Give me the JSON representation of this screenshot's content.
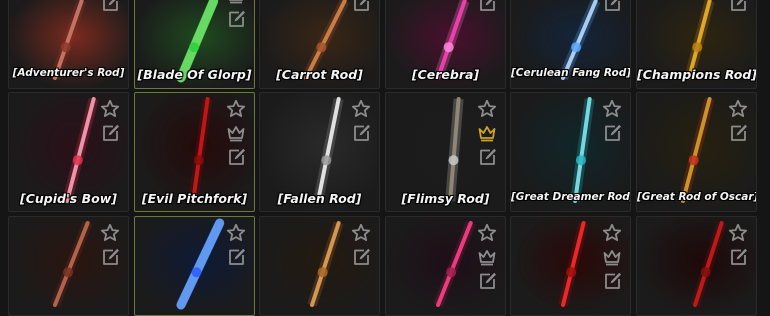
{
  "inventory": {
    "items": [
      {
        "name": "[Adventurer's Rod]",
        "icons": [
          "pencil-icon"
        ],
        "glow": "#7a2a1e",
        "shaft": "#d07a6a",
        "accent": "#8a3a2a"
      },
      {
        "name": "[Blade Of Glorp]",
        "icons": [
          "crown-icon",
          "pencil-icon"
        ],
        "glow": "#1f4a1f",
        "shaft": "#6fe86a",
        "accent": "#2ecf3a"
      },
      {
        "name": "[Carrot Rod]",
        "icons": [
          "pencil-icon"
        ],
        "glow": "#3a2615",
        "shaft": "#d7864a",
        "accent": "#a8552a"
      },
      {
        "name": "[Cerebra]",
        "icons": [
          "pencil-icon"
        ],
        "glow": "#4a0f2e",
        "shaft": "#ff3fb4",
        "accent": "#ff86dc"
      },
      {
        "name": "[Cerulean Fang Rod]",
        "icons": [
          "pencil-icon"
        ],
        "glow": "#13243a",
        "shaft": "#b8dcff",
        "accent": "#5aa8ff"
      },
      {
        "name": "[Champions Rod]",
        "icons": [
          "pencil-icon"
        ],
        "glow": "#2e2510",
        "shaft": "#f0b22e",
        "accent": "#c08010"
      },
      {
        "name": "[Cupid's Bow]",
        "icons": [
          "star-icon",
          "pencil-icon"
        ],
        "glow": "#2a1018",
        "shaft": "#ff9fb8",
        "accent": "#e2334f"
      },
      {
        "name": "[Evil Pitchfork]",
        "icons": [
          "star-icon",
          "crown-icon",
          "pencil-icon"
        ],
        "glow": "#260a0a",
        "shaft": "#d01818",
        "accent": "#8c0c0c"
      },
      {
        "name": "[Fallen Rod]",
        "icons": [
          "star-icon",
          "pencil-icon"
        ],
        "glow": "#2a2a2a",
        "shaft": "#f2f2f2",
        "accent": "#9a9a9a"
      },
      {
        "name": "[Flimsy Rod]",
        "icons": [
          "star-icon",
          "crown-icon-gold",
          "pencil-icon"
        ],
        "glow": "#1c1c1c",
        "shaft": "#9a8c78",
        "accent": "#c9c9c9"
      },
      {
        "name": "[Great Dreamer Rod]",
        "icons": [
          "star-icon",
          "pencil-icon"
        ],
        "glow": "#10262a",
        "shaft": "#7fe8ef",
        "accent": "#2ab7c6"
      },
      {
        "name": "[Great Rod of Oscar]",
        "icons": [
          "star-icon",
          "pencil-icon"
        ],
        "glow": "#26200e",
        "shaft": "#d7a02a",
        "accent": "#c43020"
      },
      {
        "name": "",
        "icons": [
          "star-icon",
          "pencil-icon"
        ],
        "glow": "#2a1510",
        "shaft": "#c06a52",
        "accent": "#7a3020"
      },
      {
        "name": "",
        "icons": [
          "star-icon",
          "pencil-icon"
        ],
        "glow": "#0e1a36",
        "shaft": "#6aa6ff",
        "accent": "#2a5cff"
      },
      {
        "name": "",
        "icons": [
          "star-icon",
          "pencil-icon"
        ],
        "glow": "#241a10",
        "shaft": "#e6a25a",
        "accent": "#a86a2a"
      },
      {
        "name": "",
        "icons": [
          "star-icon",
          "crown-icon",
          "pencil-icon"
        ],
        "glow": "#1e0e18",
        "shaft": "#ff3f8a",
        "accent": "#a0204e"
      },
      {
        "name": "",
        "icons": [
          "star-icon",
          "crown-icon",
          "pencil-icon"
        ],
        "glow": "#2a0808",
        "shaft": "#ff2a2a",
        "accent": "#a01010"
      },
      {
        "name": "",
        "icons": [
          "star-icon",
          "pencil-icon"
        ],
        "glow": "#1e0808",
        "shaft": "#d01a1a",
        "accent": "#801010"
      }
    ]
  },
  "colors": {
    "background": "#151515",
    "cell": "#1b1b1b",
    "cell_border": "#2a2a2a",
    "selected_border": "#6b7a3a",
    "icon": "#8c8c8c",
    "icon_gold": "#c9a227",
    "label": "#f4f4f4"
  }
}
